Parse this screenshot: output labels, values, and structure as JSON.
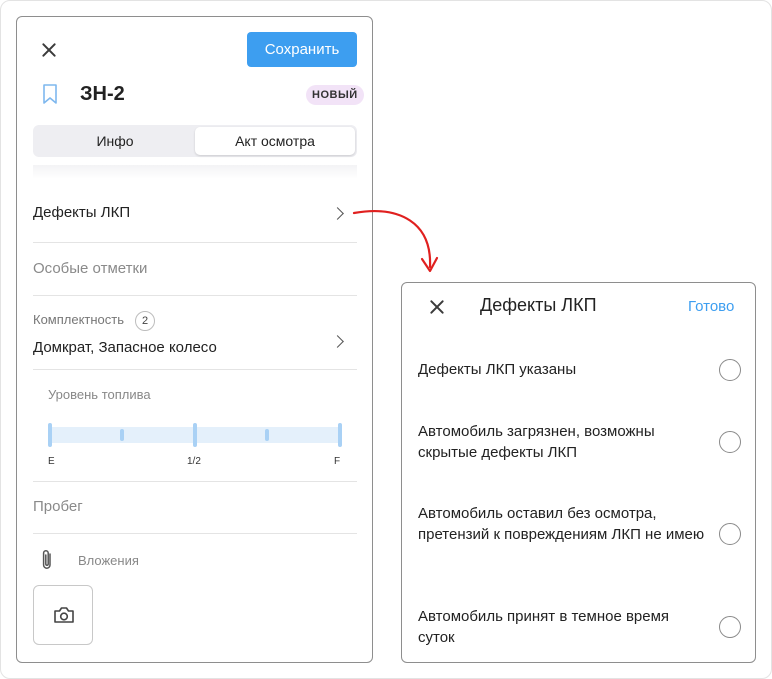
{
  "left_panel": {
    "save_label": "Сохранить",
    "doc_title": "ЗН-2",
    "badge": "НОВЫЙ",
    "tabs": [
      {
        "label": "Инфо",
        "selected": false
      },
      {
        "label": "Акт осмотра",
        "selected": true
      }
    ],
    "defects_row": "Дефекты ЛКП",
    "special_notes": "Особые отметки",
    "completeness_label": "Комплектность",
    "completeness_count": "2",
    "completeness_value": "Домкрат, Запасное колесо",
    "fuel_label": "Уровень топлива",
    "fuel_ticks": [
      "E",
      "1/2",
      "F"
    ],
    "mileage_placeholder": "Пробег",
    "attachments_label": "Вложения",
    "icons": [
      "close-icon",
      "bookmark-icon",
      "chevron-right-icon",
      "paperclip-icon",
      "camera-icon"
    ]
  },
  "right_panel": {
    "title": "Дефекты ЛКП",
    "done_label": "Готово",
    "options": [
      {
        "text": "Дефекты ЛКП указаны",
        "selected": false
      },
      {
        "text": "Автомобиль загрязнен, возможны скрытые дефекты ЛКП",
        "selected": false
      },
      {
        "text": "Автомобиль оставил без осмотра, претензий к повреждениям ЛКП не имею",
        "selected": false
      },
      {
        "text": "Автомобиль принят в темное время суток",
        "selected": false
      }
    ]
  },
  "colors": {
    "accent": "#3d9ef0",
    "badge_bg": "#f2e3f7",
    "arrow": "#e0201f",
    "fuel_track": "#e4f0fb"
  }
}
